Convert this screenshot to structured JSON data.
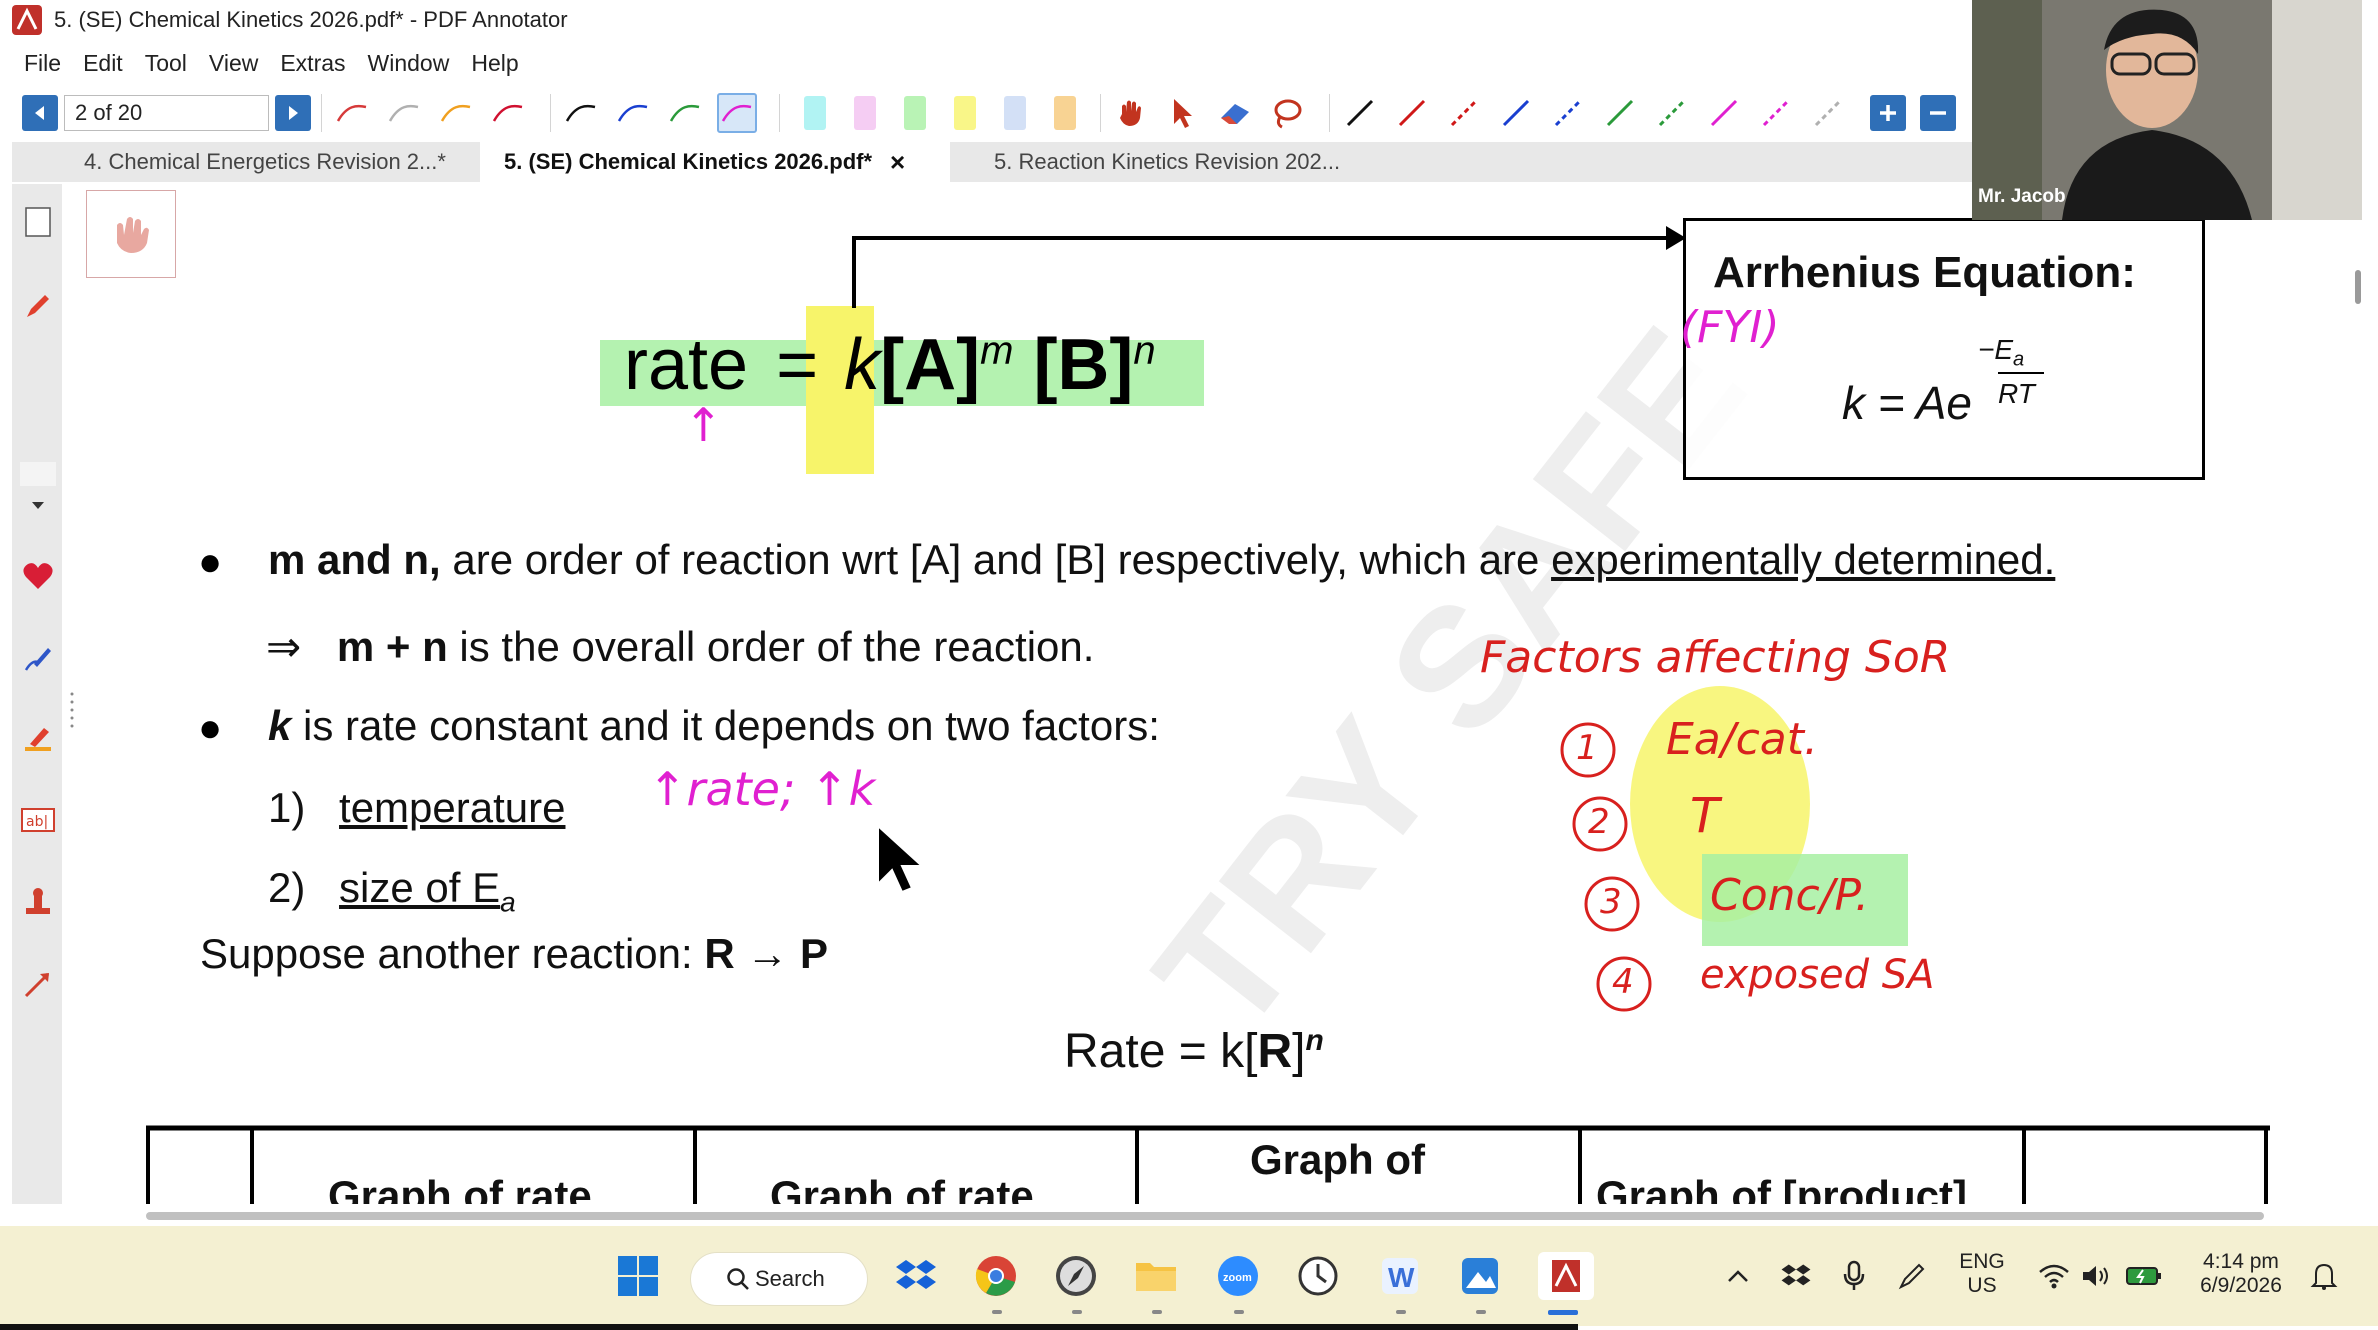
{
  "window": {
    "title": "5. (SE) Chemical Kinetics 2026.pdf* - PDF Annotator"
  },
  "menu": [
    "File",
    "Edit",
    "Tool",
    "View",
    "Extras",
    "Window",
    "Help"
  ],
  "toolbar": {
    "page_indicator": "2 of 20"
  },
  "tabs": [
    {
      "label": "4. Chemical Energetics Revision 2...*",
      "active": false
    },
    {
      "label": "5. (SE) Chemical Kinetics 2026.pdf*",
      "active": true,
      "close": "×"
    },
    {
      "label": "5. Reaction Kinetics Revision 202...",
      "active": false
    }
  ],
  "page": {
    "rate_word": "rate",
    "equals": "=",
    "k": "k",
    "bracket_A": "[A]",
    "exp_m": "m",
    "bracket_B": "[B]",
    "exp_n": "n",
    "arrhenius_title": "Arrhenius Equation:",
    "arrhenius_lhs": "k = Ae",
    "arrhenius_num": "E",
    "arrhenius_num_sub": "a",
    "arrhenius_den": "RT",
    "arrhenius_minus": "−",
    "bullet1_bold": "m and n,",
    "bullet1_rest": " are order of reaction wrt [A] and [B] respectively, which are ",
    "bullet1_under": "experimentally determined.",
    "implies": "⇒",
    "overall_bold": "m + n",
    "overall_rest": " is the overall order of the reaction.",
    "bullet2_bold": "k",
    "bullet2_rest": " is rate constant and it depends on two factors:",
    "factor1_num": "1)",
    "factor1": "temperature",
    "factor2_num": "2)",
    "factor2": "size of E",
    "factor2_sub": "a",
    "suppose_text": "Suppose another reaction: ",
    "suppose_R": "R",
    "suppose_arrow": " → ",
    "suppose_P": "P",
    "rate_eq2_text": "Rate = k[",
    "rate_eq2_R": "R",
    "rate_eq2_close": "]",
    "rate_eq2_exp": "n",
    "table_headers": [
      "",
      "Graph of rate",
      "Graph of rate",
      "Graph of",
      "Graph of [product]",
      ""
    ]
  },
  "handwriting": {
    "fyi": "(FYI)",
    "arrow_up": "↑",
    "rate_k": "↑rate; ↑k",
    "factors_title": "Factors affecting SoR",
    "item1_num": "1",
    "item1": "Ea/cat.",
    "item2_num": "2",
    "item2": "T",
    "item3_num": "3",
    "item3": "Conc/P.",
    "item4_num": "4",
    "item4": "exposed SA"
  },
  "watermark": "TRY SAFE",
  "webcam": {
    "name": "Mr. Jacob"
  },
  "taskbar": {
    "search_label": "Search",
    "lang_top": "ENG",
    "lang_bottom": "US",
    "time": "4:14 pm",
    "date": "6/9/2026"
  },
  "colors": {
    "accent_blue": "#2f6fb7",
    "highlight_green": "#a7f0a2",
    "highlight_yellow": "#f7f46a",
    "ink_magenta": "#e020d0",
    "ink_red": "#d8201e",
    "taskbar_bg": "#f4f0d2"
  }
}
